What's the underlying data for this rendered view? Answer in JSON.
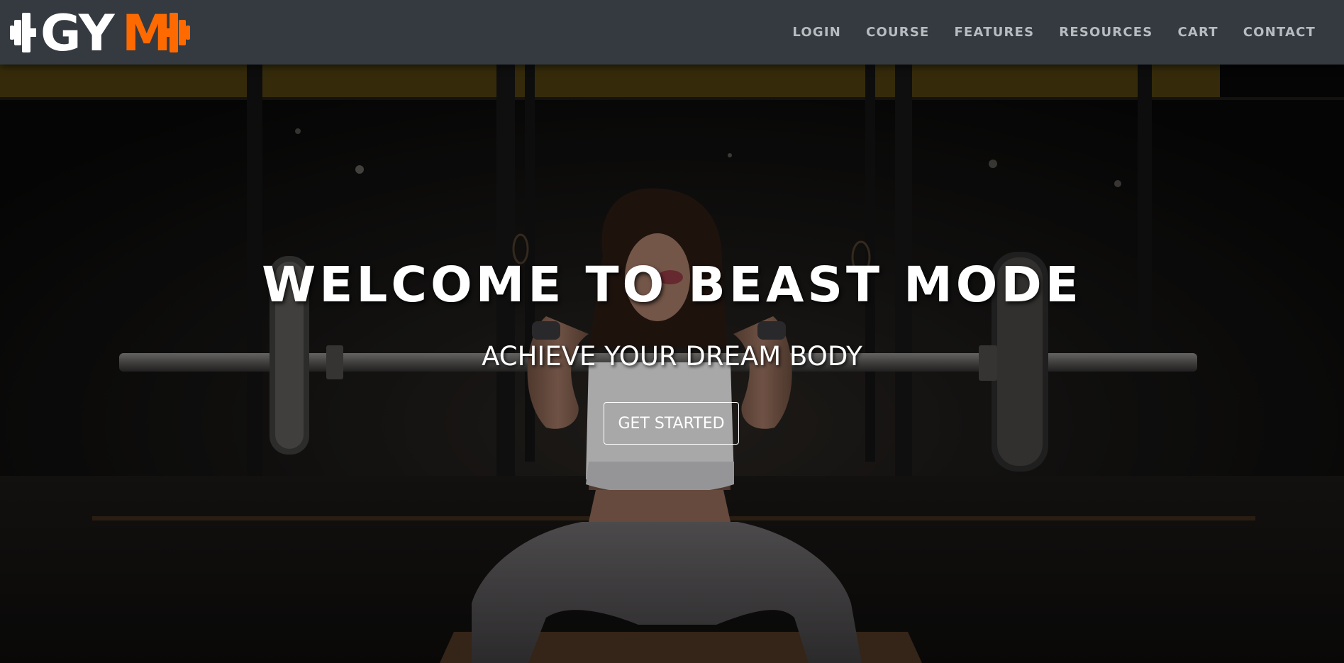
{
  "logo": {
    "part_white": "GY",
    "part_accent": "M",
    "white_color": "#ffffff",
    "accent_color": "#ff6a00",
    "icon": "dumbbell-icon"
  },
  "nav": {
    "items": [
      {
        "label": "LOGIN"
      },
      {
        "label": "COURSE"
      },
      {
        "label": "FEATURES"
      },
      {
        "label": "RESOURCES"
      },
      {
        "label": "CART"
      },
      {
        "label": "CONTACT"
      }
    ]
  },
  "hero": {
    "title": "WELCOME TO BEAST MODE",
    "subtitle": "ACHIEVE YOUR DREAM BODY",
    "cta_label": "GET STARTED"
  },
  "colors": {
    "navbar_bg": "#343a40",
    "nav_text": "#b8bcc1",
    "accent": "#ff6a00"
  }
}
